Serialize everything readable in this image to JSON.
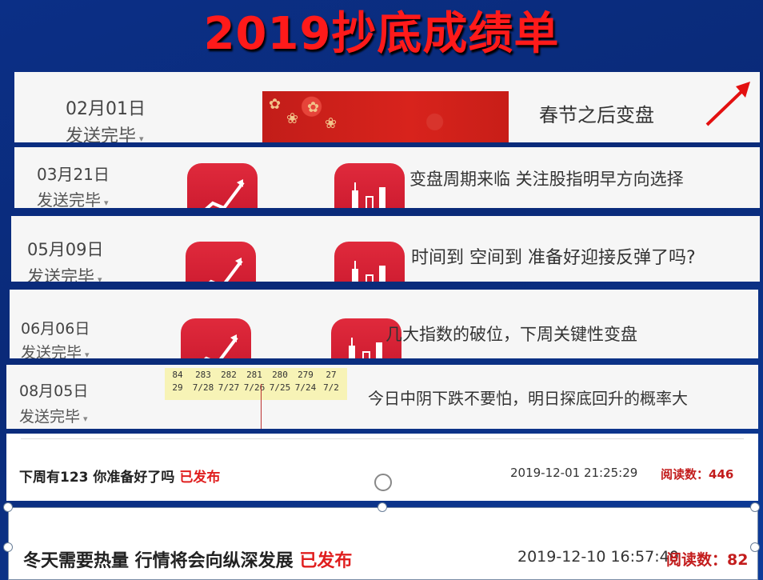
{
  "slide_title": "2019抄底成绩单",
  "rows": [
    {
      "date": "02月01日",
      "status": "发送完毕",
      "caret": "▾",
      "headline": "春节之后变盘"
    },
    {
      "date": "03月21日",
      "status": "发送完毕",
      "caret": "▾",
      "headline": "变盘周期来临 关注股指明早方向选择"
    },
    {
      "date": "05月09日",
      "status": "发送完毕",
      "caret": "▾",
      "headline": "时间到 空间到 准备好迎接反弹了吗?"
    },
    {
      "date": "06月06日",
      "status": "发送完毕",
      "caret": "▾",
      "headline": "几大指数的破位，下周关键性变盘"
    },
    {
      "date": "08月05日",
      "status": "发送完毕",
      "caret": "▾",
      "headline": "今日中阴下跌不要怕，明日探底回升的概率大"
    }
  ],
  "stock_strip": {
    "top": [
      "84",
      "283",
      "282",
      "281",
      "280",
      "279",
      "27"
    ],
    "bottom": [
      "29",
      "7/28",
      "7/27",
      "7/26",
      "7/25",
      "7/24",
      "7/2"
    ]
  },
  "articles": [
    {
      "title": "下周有123 你准备好了吗 ",
      "published": "已发布",
      "datetime": "2019-12-01 21:25:29",
      "reads_label": "阅读数：",
      "reads_value": "446"
    },
    {
      "title": "冬天需要热量 行情将会向纵深发展 ",
      "published": "已发布",
      "datetime": "2019-12-10 16:57:40",
      "reads_label": "阅读数：",
      "reads_value": "82"
    }
  ],
  "colors": {
    "title_red": "#ff1a1a",
    "background_blue": "#0b2f86",
    "icon_red": "#d11a30",
    "publish_red": "#e01e1e"
  }
}
